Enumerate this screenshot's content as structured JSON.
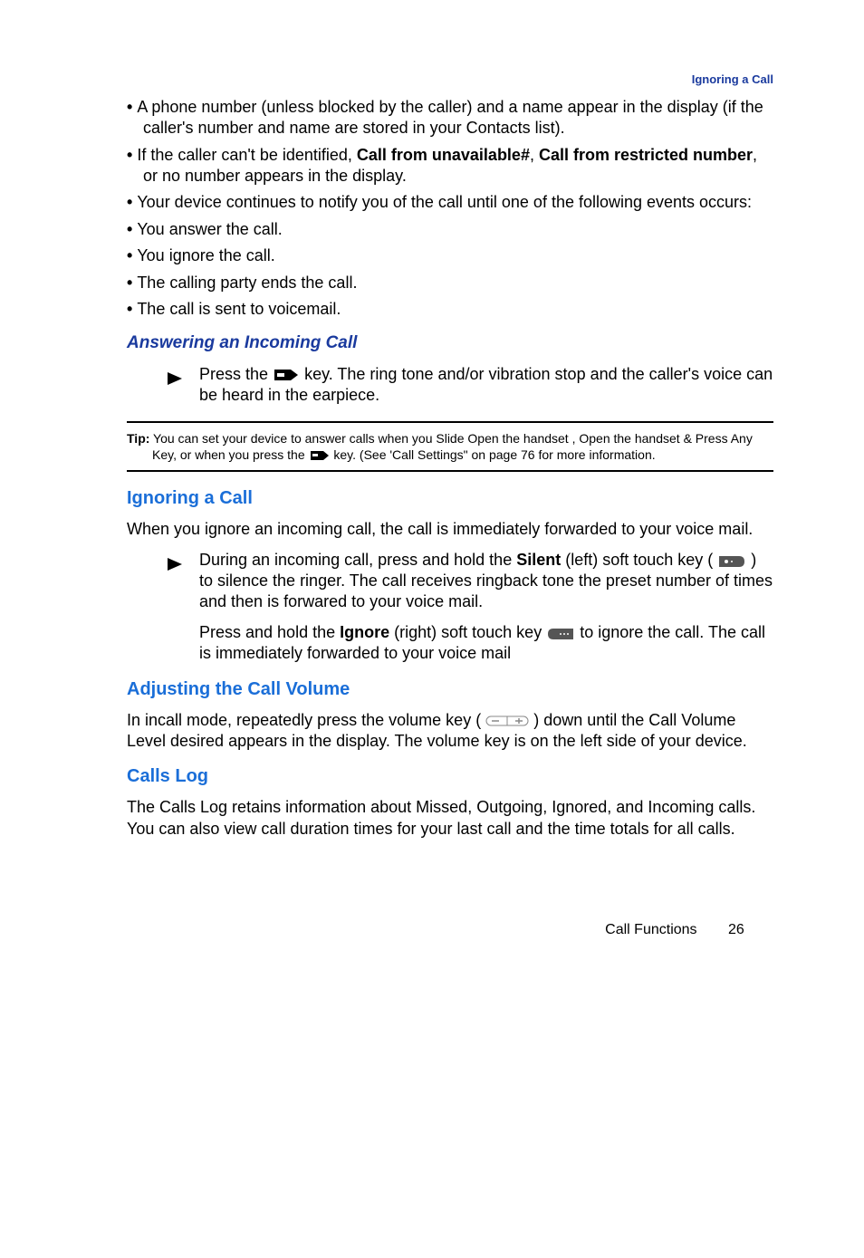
{
  "header": {
    "breadcrumb": "Ignoring a Call"
  },
  "bullets": [
    {
      "pre": "A phone number (unless blocked by the caller) and a name appear in the display (if the caller's number and name are stored in your Contacts list)."
    },
    {
      "pre": "If the caller can't be identified, ",
      "b1": "Call from unavailable#",
      "mid": ", ",
      "b2": "Call from restricted number",
      "post": ", or no number appears in the display."
    },
    {
      "pre": "Your device continues to notify you of the call until one of the following events occurs:"
    },
    {
      "pre": "You answer the call."
    },
    {
      "pre": "You ignore the call."
    },
    {
      "pre": "The calling party ends the call."
    },
    {
      "pre": "The call is sent to voicemail."
    }
  ],
  "answering": {
    "heading": "Answering an Incoming Call",
    "step_pre": "Press the ",
    "step_post": " key. The ring tone and/or vibration stop and the caller's voice can be heard in the earpiece."
  },
  "tip": {
    "label": "Tip:",
    "line1": " You can set your device to answer calls when you Slide Open the handset , Open the handset & Press Any Key, or when you press the ",
    "line2": " key. (See 'Call Settings\" on page 76 for more information."
  },
  "ignoring": {
    "heading": "Ignoring a Call",
    "para": "When you ignore an incoming call, the call is immediately forwarded to your voice mail.",
    "step1_pre": "During an incoming call, press and hold the ",
    "step1_b": "Silent",
    "step1_mid": " (left) soft touch key ( ",
    "step1_post": " ) to silence the ringer. The call receives ringback tone the preset number of times and then is forwared to your voice mail.",
    "step2_pre": "Press and hold the ",
    "step2_b": "Ignore",
    "step2_mid": " (right) soft touch key ",
    "step2_post": " to ignore the call. The call is immediately forwarded to your voice mail"
  },
  "volume": {
    "heading": "Adjusting the Call Volume",
    "para_pre": "In incall mode, repeatedly press the volume key ( ",
    "para_post": " ) down until the Call Volume Level desired appears in the display. The volume key is on the left side of your device."
  },
  "callslog": {
    "heading": "Calls Log",
    "para": "The Calls Log retains information about Missed, Outgoing, Ignored, and Incoming calls. You can also view call duration times for your last call and the time totals for all calls."
  },
  "footer": {
    "label": "Call Functions",
    "page": "26"
  }
}
